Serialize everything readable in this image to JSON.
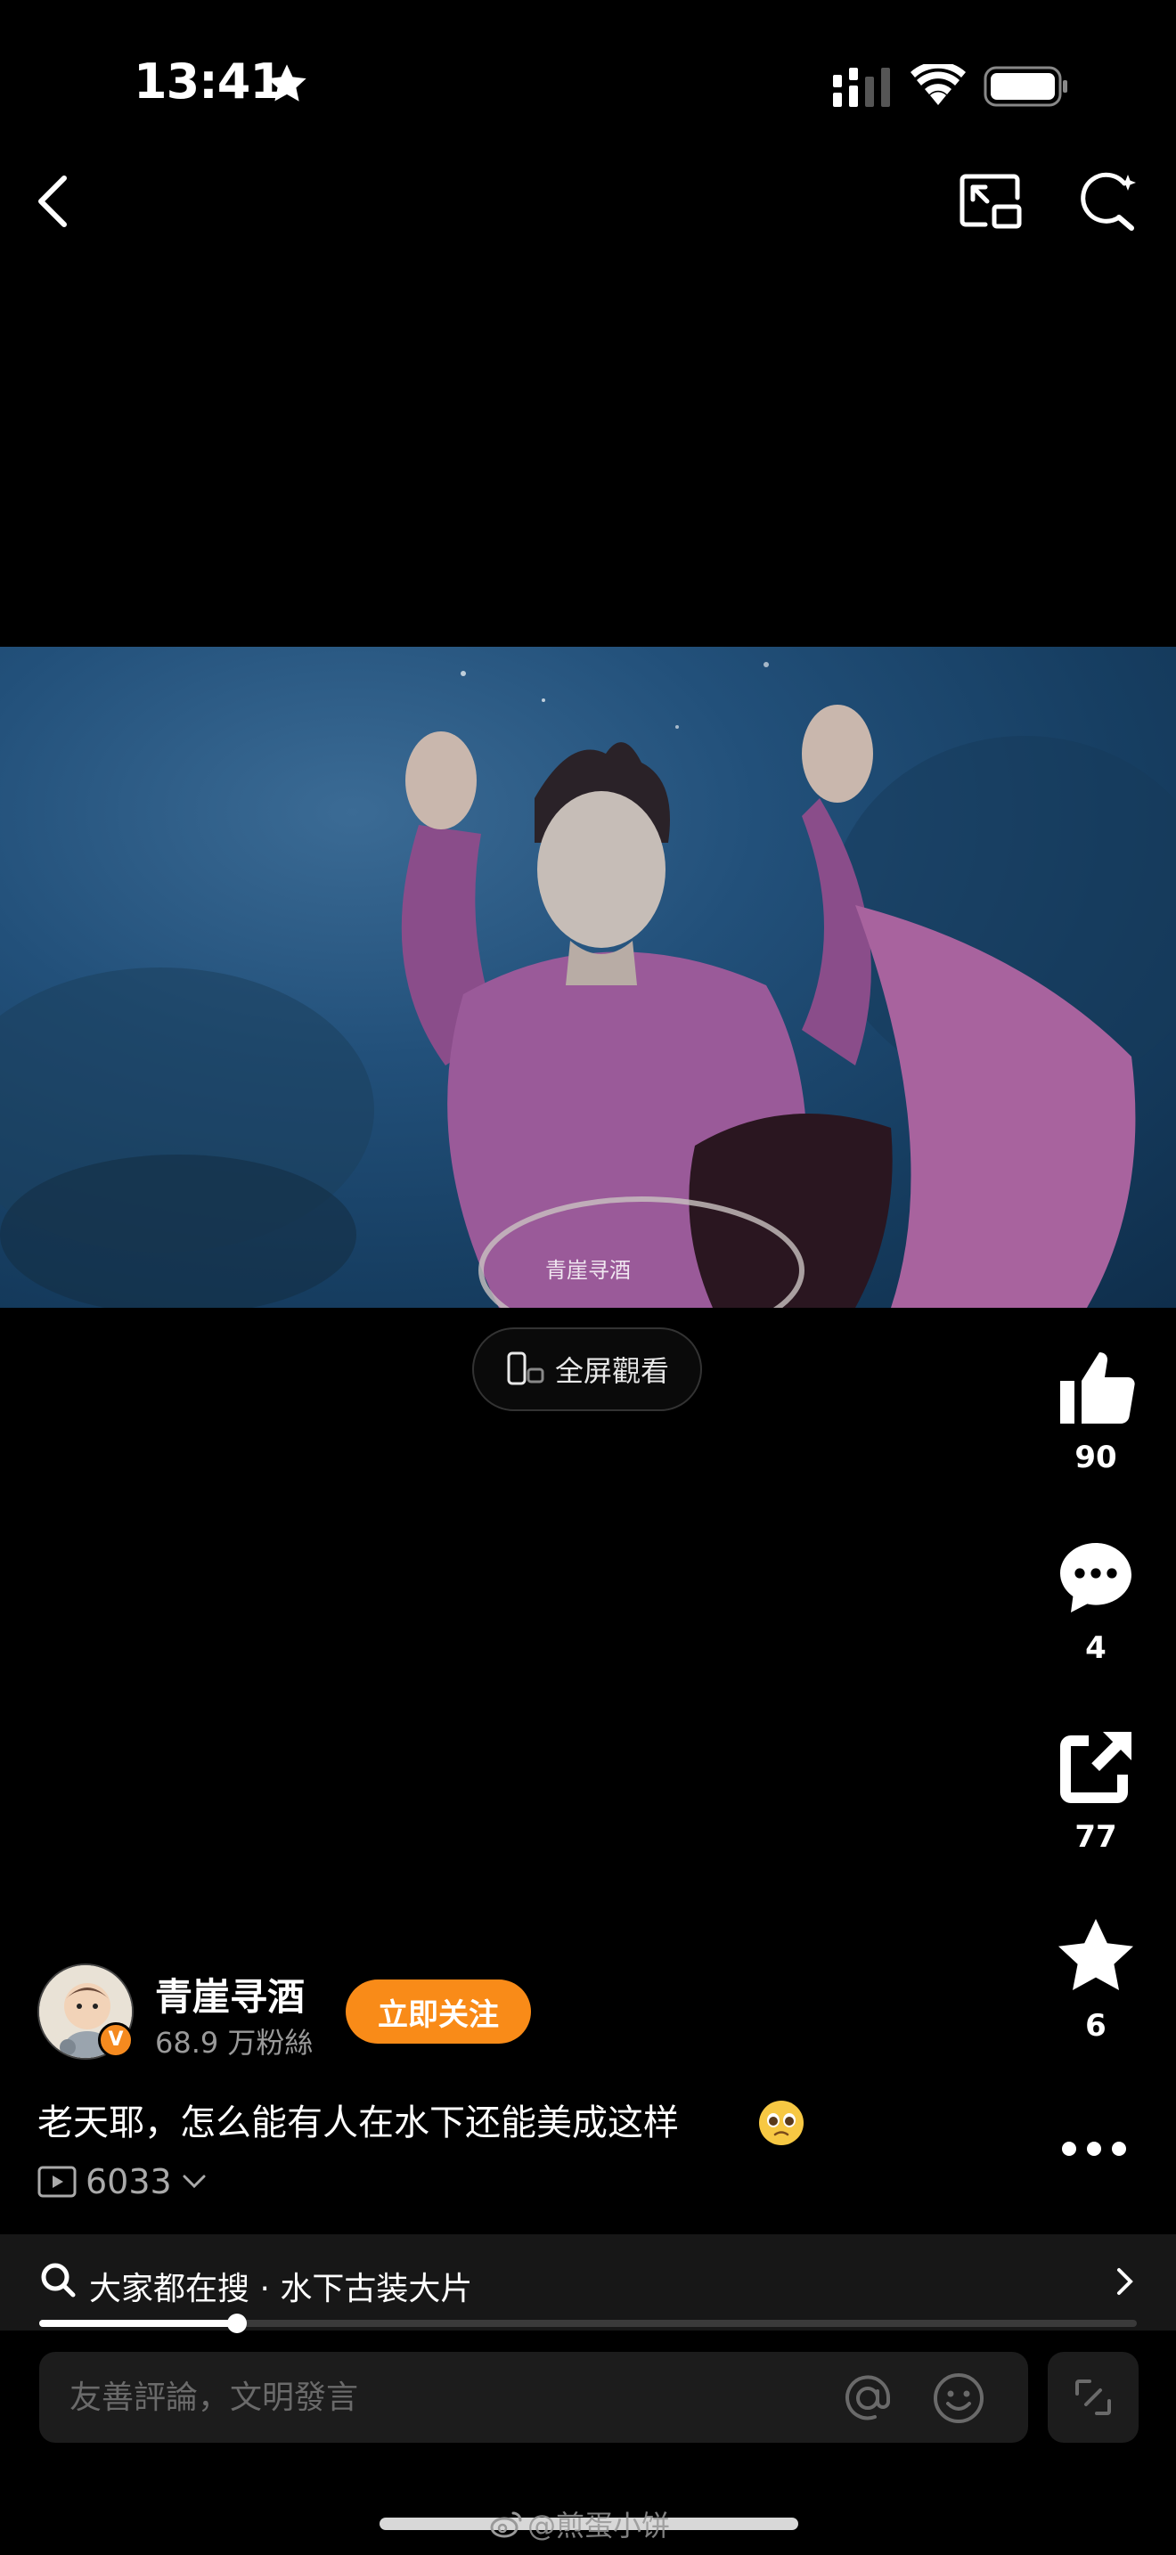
{
  "status_bar": {
    "time": "13:41"
  },
  "video": {
    "watermark": "青崖寻酒"
  },
  "fullscreen": {
    "label": "全屏觀看"
  },
  "actions": {
    "like_count": "90",
    "comment_count": "4",
    "share_count": "77",
    "favorite_count": "6"
  },
  "author": {
    "name": "青崖寻酒",
    "fans": "68.9 万粉絲",
    "follow_label": "立即关注",
    "badge": "V"
  },
  "caption": {
    "text": "老天耶，怎么能有人在水下还能美成这样"
  },
  "views": {
    "count": "6033"
  },
  "search_suggestion": {
    "text": "大家都在搜 · 水下古装大片"
  },
  "playback": {
    "progress_fraction": 0.18
  },
  "comment_bar": {
    "placeholder": "友善評論，文明發言"
  },
  "overlay": {
    "weibo_watermark": "@煎蛋小饼"
  },
  "colors": {
    "accent": "#f98b18",
    "background": "#000000"
  }
}
